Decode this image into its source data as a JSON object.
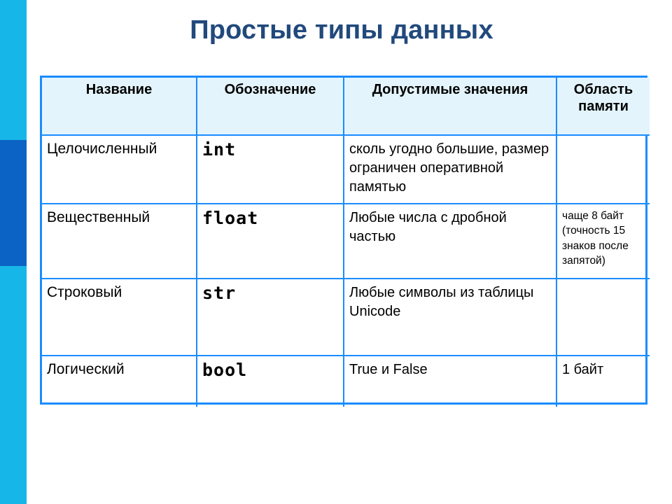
{
  "slide": {
    "title": "Простые типы данных",
    "title_color": "#21497c",
    "accent_cyan": "#17b6e8",
    "accent_dark_blue": "#0b63c5",
    "table_border_color": "#1a8cff",
    "header_fill": "#e3f4fc"
  },
  "table": {
    "headers": {
      "col1": "Название",
      "col2": "Обозначение",
      "col3": "Допустимые значения",
      "col4": "Область памяти"
    },
    "rows": [
      {
        "name": "Целочисленный",
        "code": "int",
        "values": "сколь угодно большие, размер ограничен оперативной памятью",
        "memory": ""
      },
      {
        "name": "Вещественный",
        "code": "float",
        "values": "Любые числа с дробной частью",
        "memory": "чаще 8 байт (точность 15 знаков после запятой)"
      },
      {
        "name": "Строковый",
        "code": "str",
        "values": "Любые символы из таблицы Unicode",
        "memory": ""
      },
      {
        "name": "Логический",
        "code": "bool",
        "values": "True и False",
        "memory": "1 байт"
      }
    ]
  }
}
